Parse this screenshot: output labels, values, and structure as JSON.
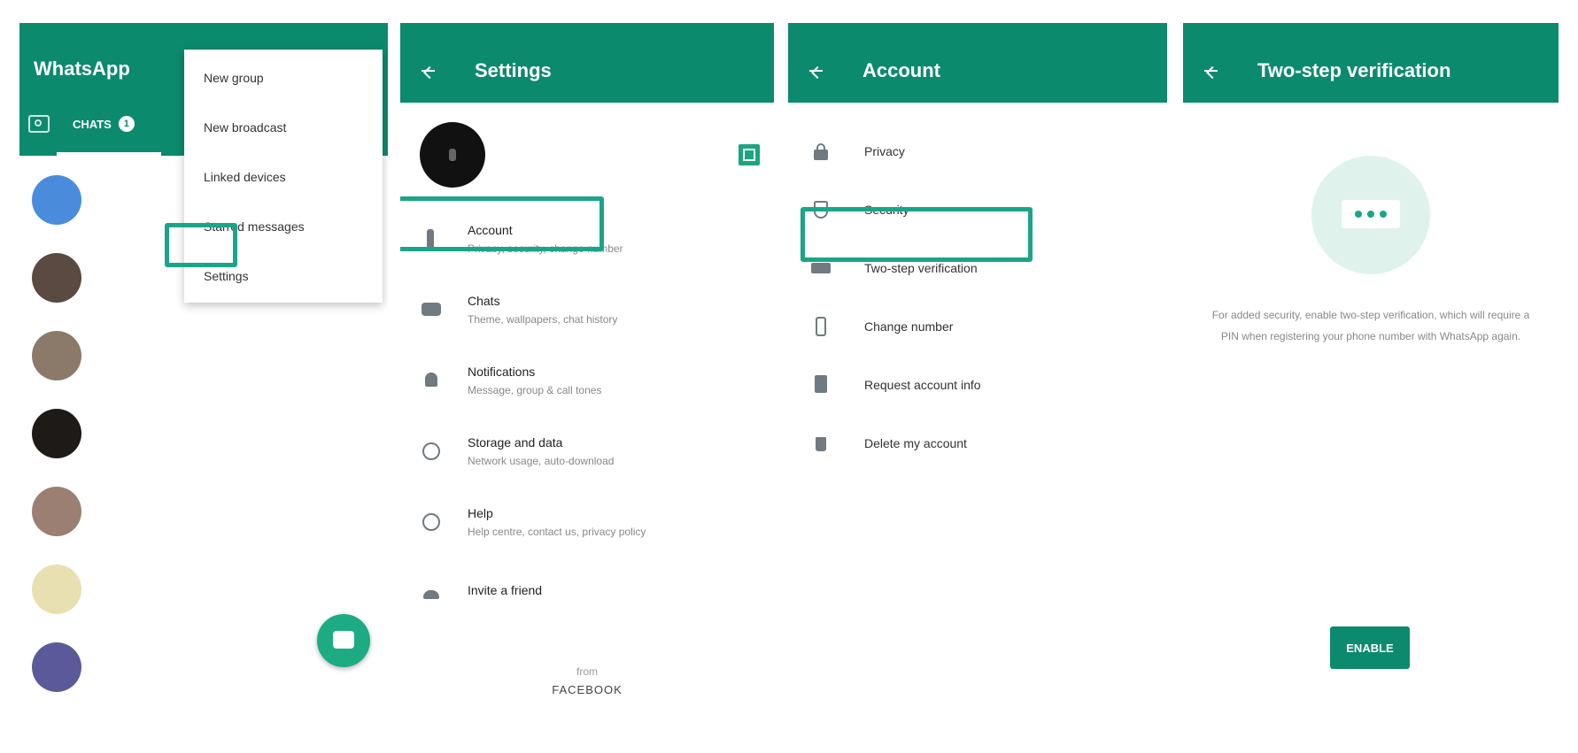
{
  "statusbar": {
    "time": "",
    "right": ""
  },
  "screen1": {
    "title": "WhatsApp",
    "tab_chats": "CHATS",
    "tab_badge": "1",
    "menu": [
      "New group",
      "New broadcast",
      "Linked devices",
      "Starred messages",
      "Settings"
    ],
    "chats": [
      {
        "name": "",
        "message": "",
        "time": "",
        "unread": "",
        "avatar_color": "#4a8cdb"
      },
      {
        "name": "",
        "message": "",
        "time": "",
        "unread": "",
        "avatar_color": "#5a4a42"
      },
      {
        "name": "",
        "message": "",
        "time": "",
        "unread": "",
        "avatar_color": "#8b7a6a"
      },
      {
        "name": "",
        "message": "",
        "time": "",
        "unread": "",
        "avatar_color": "#1e1a18"
      },
      {
        "name": "",
        "message": "",
        "time": "",
        "unread": "",
        "avatar_color": "#9a7f72"
      },
      {
        "name": "",
        "message": "",
        "time": "",
        "unread": "",
        "avatar_color": "#e8e0b0"
      },
      {
        "name": "",
        "message": "",
        "time": "",
        "unread": "",
        "avatar_color": "#5a5a9a"
      }
    ]
  },
  "screen2": {
    "title": "Settings",
    "profile_name": "",
    "profile_about": "",
    "items": [
      {
        "title": "Account",
        "subtitle": "Privacy, security, change number"
      },
      {
        "title": "Chats",
        "subtitle": "Theme, wallpapers, chat history"
      },
      {
        "title": "Notifications",
        "subtitle": "Message, group & call tones"
      },
      {
        "title": "Storage and data",
        "subtitle": "Network usage, auto-download"
      },
      {
        "title": "Help",
        "subtitle": "Help centre, contact us, privacy policy"
      },
      {
        "title": "Invite a friend",
        "subtitle": ""
      }
    ],
    "from_label": "from",
    "from_brand": "FACEBOOK"
  },
  "screen3": {
    "title": "Account",
    "items": [
      "Privacy",
      "Security",
      "Two-step verification",
      "Change number",
      "Request account info",
      "Delete my account"
    ]
  },
  "screen4": {
    "title": "Two-step verification",
    "description": "For added security, enable two-step verification, which will require a PIN when registering your phone number with WhatsApp again.",
    "button": "ENABLE"
  },
  "colors": {
    "brand": "#0c8a6e",
    "highlight": "#1aa58a",
    "unread": "#25d366",
    "fab": "#1dab84"
  }
}
